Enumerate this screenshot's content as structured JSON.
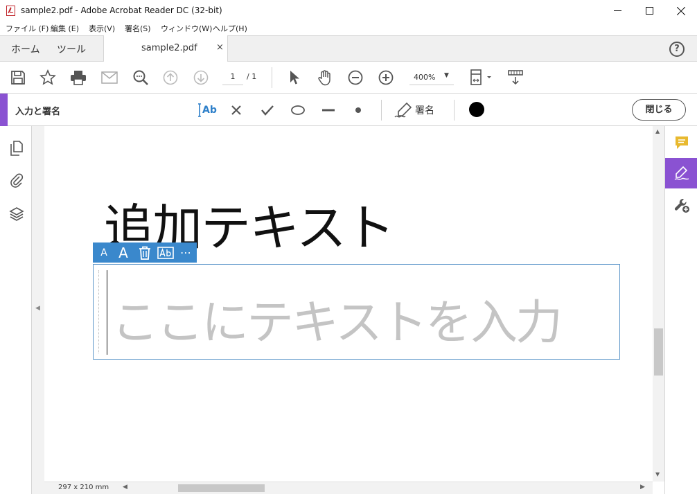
{
  "window": {
    "title": "sample2.pdf - Adobe Acrobat Reader DC (32-bit)"
  },
  "menu": {
    "items": [
      "ファイル (F)",
      "編集 (E)",
      "表示(V)",
      "署名(S)",
      "ウィンドウ(W)",
      "ヘルプ(H)"
    ]
  },
  "tabs": {
    "home": "ホーム",
    "tools": "ツール",
    "document": "sample2.pdf",
    "close_glyph": "×",
    "help_glyph": "?"
  },
  "toolbar": {
    "page_current": "1",
    "page_total": "/ 1",
    "zoom": "400%"
  },
  "fill_sign": {
    "title": "入力と署名",
    "sign_label": "署名",
    "close_label": "閉じる",
    "text_tool_label": "Ab",
    "ink_color": "#000000"
  },
  "document": {
    "heading": "追加テキスト",
    "field_placeholder": "ここにテキストを入力",
    "page_size": "297 x 210 mm"
  },
  "floating_toolbar": {
    "small_a": "A",
    "large_a": "A",
    "more": "⋯"
  },
  "colors": {
    "accent_purple": "#8a52d2",
    "field_blue": "#3a88cc",
    "comment_yellow": "#e8b92f"
  }
}
